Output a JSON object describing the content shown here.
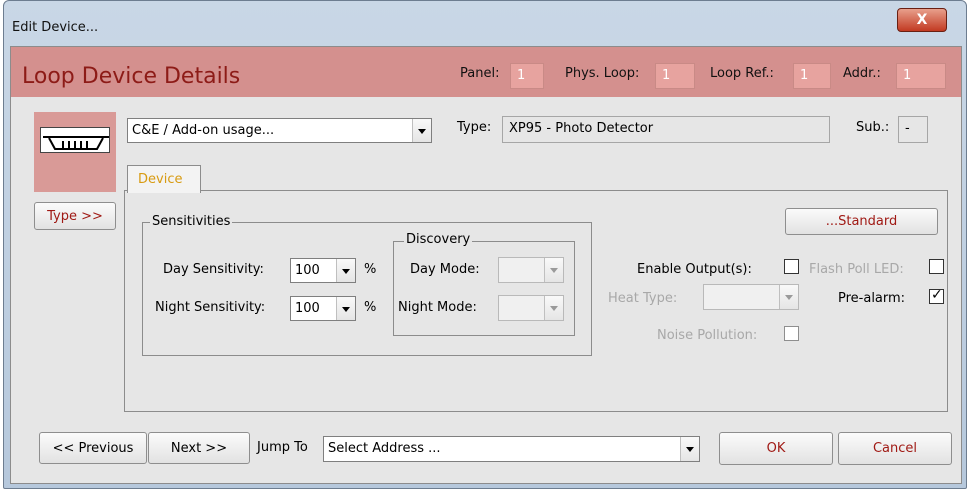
{
  "window": {
    "title": "Edit Device...",
    "close_glyph": "X"
  },
  "header": {
    "title": "Loop Device Details",
    "fields": [
      {
        "label": "Panel:",
        "value": "1"
      },
      {
        "label": "Phys. Loop:",
        "value": "1"
      },
      {
        "label": "Loop Ref.:",
        "value": "1"
      },
      {
        "label": "Addr.:",
        "value": "1"
      }
    ]
  },
  "device": {
    "usage_select": "C&E / Add-on usage...",
    "type_label": "Type:",
    "type_value": "XP95 - Photo Detector",
    "sub_label": "Sub.:",
    "sub_value": "-",
    "type_button": "Type >>"
  },
  "tabs": [
    {
      "label": "Device",
      "active": true
    }
  ],
  "sensitivities": {
    "group_label": "Sensitivities",
    "day_label": "Day Sensitivity:",
    "day_value": "100",
    "night_label": "Night Sensitivity:",
    "night_value": "100",
    "unit": "%"
  },
  "discovery": {
    "group_label": "Discovery",
    "day_mode_label": "Day Mode:",
    "night_mode_label": "Night Mode:"
  },
  "options": {
    "standard_button": "...Standard",
    "enable_outputs_label": "Enable Output(s):",
    "enable_outputs_checked": false,
    "flash_poll_label": "Flash Poll LED:",
    "flash_poll_checked": false,
    "heat_type_label": "Heat Type:",
    "pre_alarm_label": "Pre-alarm:",
    "pre_alarm_checked": true,
    "noise_pollution_label": "Noise Pollution:",
    "noise_pollution_checked": false
  },
  "footer": {
    "previous": "<< Previous",
    "next": "Next >>",
    "jump_label": "Jump To",
    "jump_value": "Select Address ...",
    "ok": "OK",
    "cancel": "Cancel"
  },
  "colors": {
    "header_bg": "#d4908e",
    "header_title": "#8d1b17",
    "accent_text": "#a01a15",
    "tab_text": "#d89b12"
  }
}
